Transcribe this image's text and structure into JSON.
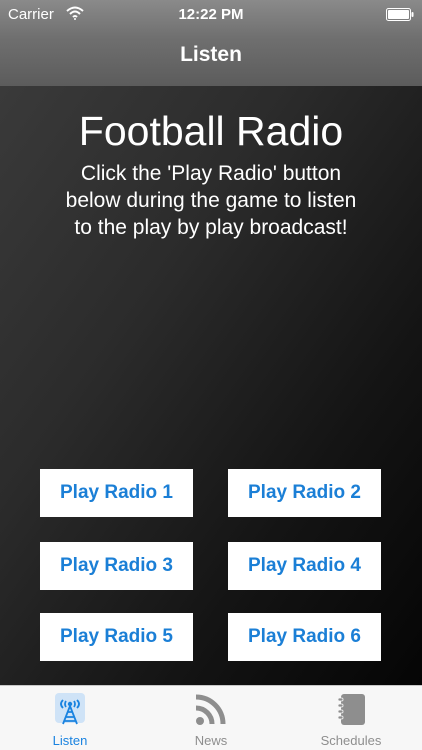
{
  "status_bar": {
    "carrier": "Carrier",
    "time": "12:22 PM"
  },
  "nav": {
    "title": "Listen"
  },
  "hero": {
    "title": "Football Radio",
    "description": "Click the 'Play Radio' button below during the game to listen to the play by play broadcast!"
  },
  "buttons": [
    {
      "label": "Play Radio 1"
    },
    {
      "label": "Play Radio 2"
    },
    {
      "label": "Play Radio 3"
    },
    {
      "label": "Play Radio 4"
    },
    {
      "label": "Play Radio 5"
    },
    {
      "label": "Play Radio 6"
    }
  ],
  "tabs": [
    {
      "label": "Listen",
      "icon": "radio-tower-icon",
      "selected": true
    },
    {
      "label": "News",
      "icon": "rss-icon",
      "selected": false
    },
    {
      "label": "Schedules",
      "icon": "notebook-icon",
      "selected": false
    }
  ],
  "colors": {
    "accent": "#1b7fd6",
    "tab_selected": "#1a83e0",
    "tab_unselected": "#8e8e8e"
  }
}
